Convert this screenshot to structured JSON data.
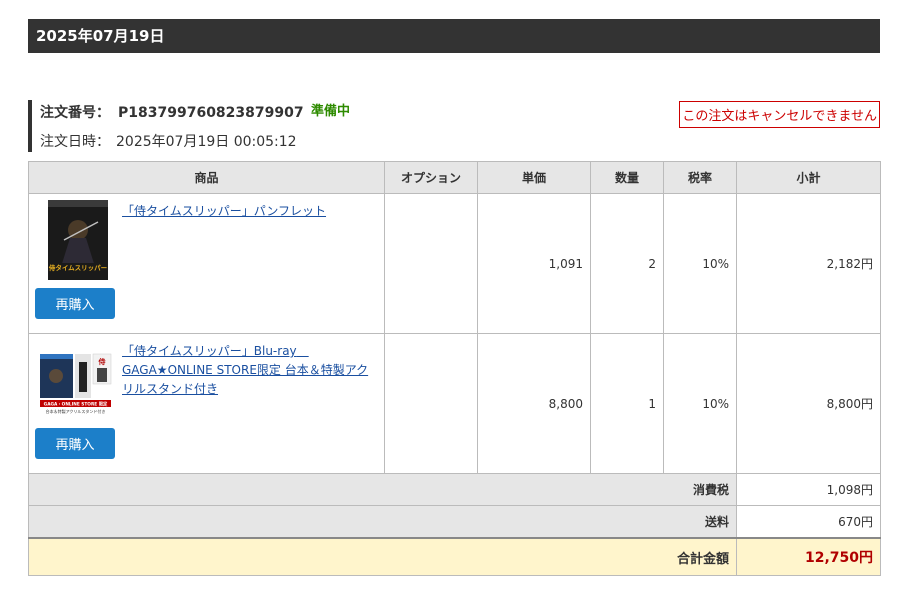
{
  "order_date_header": "2025年07月19日",
  "order": {
    "number_label": "注文番号：",
    "number": "P183799760823879907",
    "status": "準備中",
    "datetime_label": "注文日時：",
    "datetime": "2025年07月19日 00:05:12",
    "cancel_note": "この注文はキャンセルできません"
  },
  "table": {
    "headers": {
      "product": "商品",
      "option": "オプション",
      "unit_price": "単価",
      "quantity": "数量",
      "tax_rate": "税率",
      "subtotal": "小計"
    },
    "rows": [
      {
        "name": "「侍タイムスリッパー」パンフレット",
        "option": "",
        "unit_price": "1,091",
        "quantity": "2",
        "tax_rate": "10%",
        "subtotal": "2,182円",
        "rebuy_label": "再購入",
        "thumb_title": "侍タイムスリッパー"
      },
      {
        "name": "「侍タイムスリッパー」Blu-ray　GAGA★ONLINE STORE限定 台本＆特製アクリルスタンド付き",
        "option": "",
        "unit_price": "8,800",
        "quantity": "1",
        "tax_rate": "10%",
        "subtotal": "8,800円",
        "rebuy_label": "再購入",
        "thumb_title": "GAGA・ONLINE STORE 限定",
        "thumb_subtitle": "台本＆特製アクリルスタンド付き"
      }
    ]
  },
  "totals": {
    "tax_label": "消費税",
    "tax": "1,098円",
    "shipping_label": "送料",
    "shipping": "670円",
    "grand_label": "合計金額",
    "grand": "12,750円"
  },
  "colors": {
    "status": "#2e8b00",
    "cancel": "#cc0000",
    "rebuy_button": "#1c7fc9",
    "grand_total": "#b00000",
    "grand_row_bg": "#fff5cc",
    "header_bar": "#333333"
  }
}
